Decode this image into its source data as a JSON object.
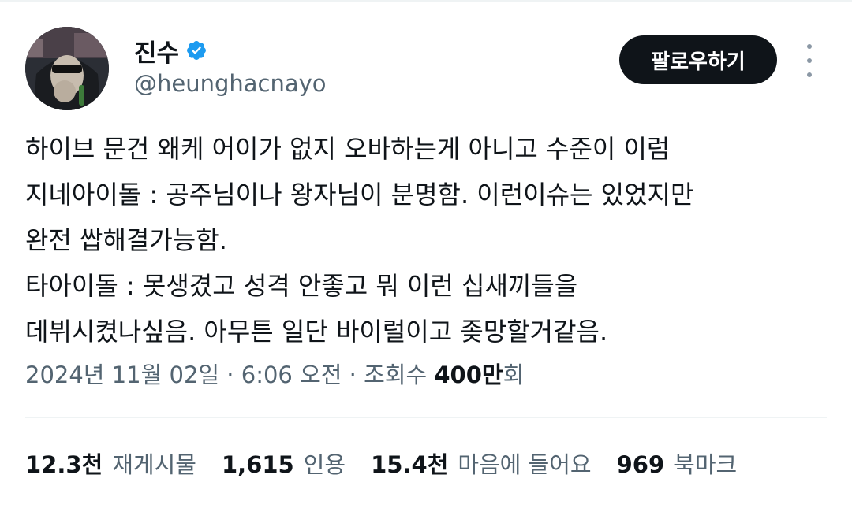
{
  "author": {
    "display_name": "진수",
    "handle": "@heunghacnayo",
    "verified": true,
    "verified_icon": "verified-badge-icon",
    "verified_color": "#1d9bf0"
  },
  "actions": {
    "follow_label": "팔로우하기",
    "more_icon": "more-vertical-icon"
  },
  "tweet": {
    "lines": [
      "하이브 문건 왜케 어이가 없지 오바하는게 아니고 수준이 이럼",
      "지네아이돌 : 공주님이나 왕자님이 분명함. 이런이슈는 있었지만",
      "완전 쌉해결가능함.",
      "타아이돌 : 못생겼고 성격 안좋고 뭐 이런 십새끼들을",
      "데뷔시켰나싶음. 아무튼 일단 바이럴이고 좆망할거같음."
    ]
  },
  "meta": {
    "date": "2024년 11월 02일",
    "separator": " · ",
    "time": "6:06 오전",
    "views_label": "조회수",
    "views_count": "400만",
    "views_suffix": "회"
  },
  "stats": [
    {
      "count": "12.3천",
      "label": "재게시물"
    },
    {
      "count": "1,615",
      "label": "인용"
    },
    {
      "count": "15.4천",
      "label": "마음에 들어요"
    },
    {
      "count": "969",
      "label": "북마크"
    }
  ],
  "colors": {
    "text_primary": "#0f1419",
    "text_secondary": "#536471",
    "button_bg": "#0f1419",
    "divider": "#eff3f4"
  }
}
